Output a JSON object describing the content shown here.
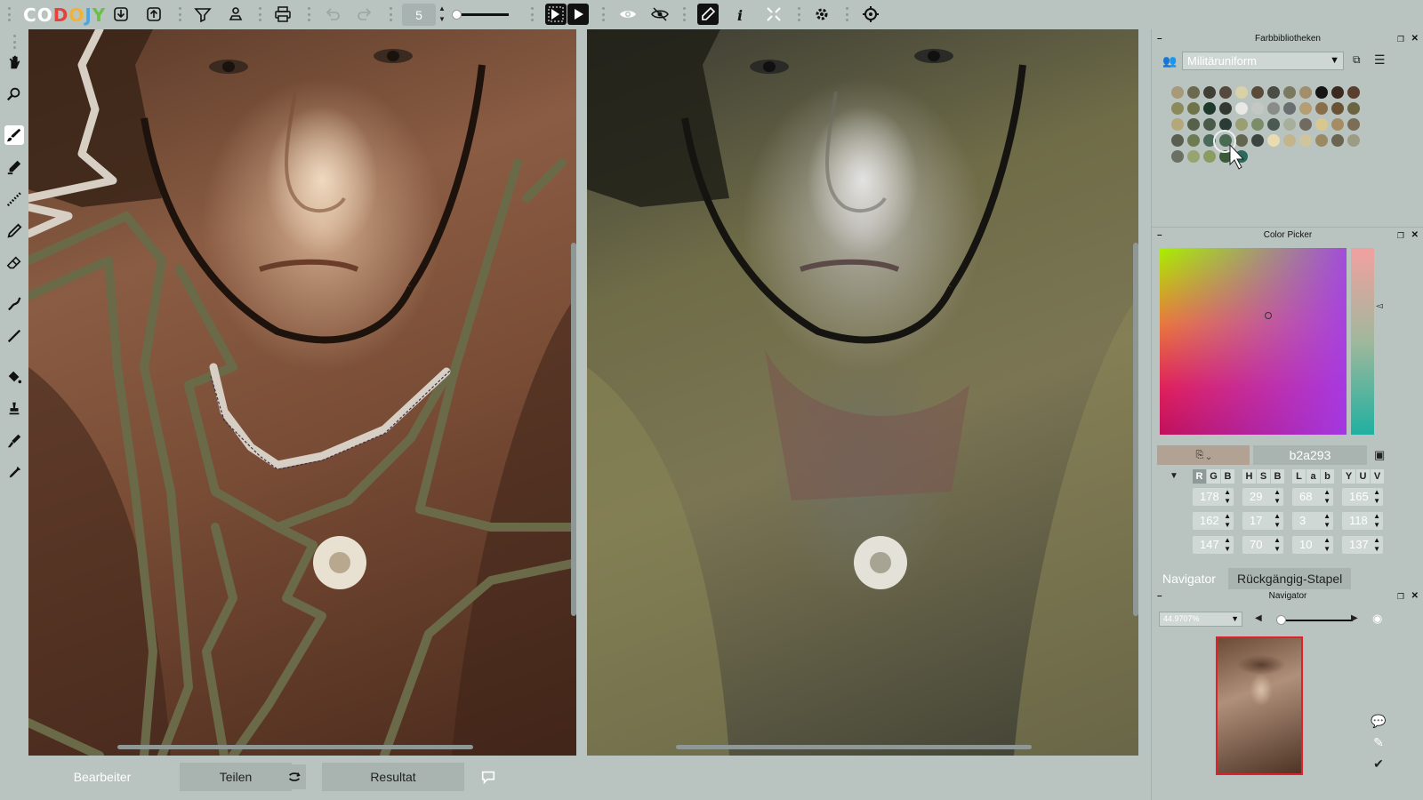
{
  "app": {
    "logo_letters": [
      {
        "ch": "C",
        "color": "#ffffff"
      },
      {
        "ch": "O",
        "color": "#ffffff"
      },
      {
        "ch": "D",
        "color": "#e8413c"
      },
      {
        "ch": "O",
        "color": "#f2b233"
      },
      {
        "ch": "J",
        "color": "#4aa8e0"
      },
      {
        "ch": "Y",
        "color": "#6cc04a"
      }
    ]
  },
  "toolbar": {
    "brush_size": "5",
    "icons": [
      "import-icon",
      "export-icon",
      "funnel-icon",
      "stamp-icon",
      "print-icon",
      "undo-icon",
      "redo-icon",
      "play-pause-icon",
      "play-icon",
      "eye-icon",
      "eye-crossed-icon",
      "pen-icon",
      "info-icon",
      "expand-icon",
      "settings-icon",
      "preferences-icon"
    ]
  },
  "tools": [
    "hand-icon",
    "zoom-icon",
    "brush-icon",
    "marker-icon",
    "dotted-brush-icon",
    "pencil-icon",
    "eraser-icon",
    "smudge-icon",
    "line-icon",
    "fill-bucket-icon",
    "stamp-tool-icon",
    "color-dropper-brush-icon",
    "eyedropper-icon"
  ],
  "bottom_tabs": {
    "editor": "Bearbeiter",
    "share": "Teilen",
    "result": "Resultat"
  },
  "color_library": {
    "title": "Farbbibliotheken",
    "selected": "Militäruniform",
    "swatches": [
      [
        "#a89a78",
        "#6b6a4e",
        "#3f3f36",
        "#55483c",
        "#d9d2a6",
        "#5a4a3a",
        "#4a4d44",
        "#7a7a60",
        "#a38e6c",
        "#151515",
        "#3c2a20",
        "#5a3e2e"
      ],
      [
        "#8c8a5a",
        "#6e7448",
        "#1e3a2c",
        "#333830",
        "#e8e8e4",
        "#c4c8c4",
        "#8a8c88",
        "#6a6e70",
        "#b69e74",
        "#8a6e4a",
        "#6a5234",
        "#6a6442"
      ],
      [
        "#b4a87a",
        "#56604a",
        "#4a5a48",
        "#2a3a34",
        "#9a9e70",
        "#7a8c68",
        "#4a5a52",
        "#a8ae9c",
        "#706a60",
        "#d8c890",
        "#a68c62",
        "#7a6e56"
      ],
      [
        "#5a5e50",
        "#6e7a52",
        "#4a6a5a",
        "#4a6a52",
        "#62664e",
        "#3c4440",
        "#e8dcb0",
        "#c4b48c",
        "#d0c49c",
        "#9a8a64",
        "#6a6450",
        "#9c9c84"
      ],
      [
        "#6a7064",
        "#98a470",
        "#8a9c62",
        "#3a5a3a",
        "#2a6a5a"
      ]
    ]
  },
  "color_picker": {
    "title": "Color Picker",
    "hex": "b2a293",
    "modes": {
      "rgb": [
        "R",
        "G",
        "B"
      ],
      "hsb": [
        "H",
        "S",
        "B"
      ],
      "lab": [
        "L",
        "a",
        "b"
      ],
      "yuv": [
        "Y",
        "U",
        "V"
      ]
    },
    "values": [
      [
        "178",
        "29",
        "68",
        "165"
      ],
      [
        "162",
        "17",
        "3",
        "118"
      ],
      [
        "147",
        "70",
        "10",
        "137"
      ]
    ]
  },
  "navigator": {
    "tab_navigator": "Navigator",
    "tab_undo": "Rückgängig-Stapel",
    "title": "Navigator",
    "zoom": "44.9707%"
  }
}
